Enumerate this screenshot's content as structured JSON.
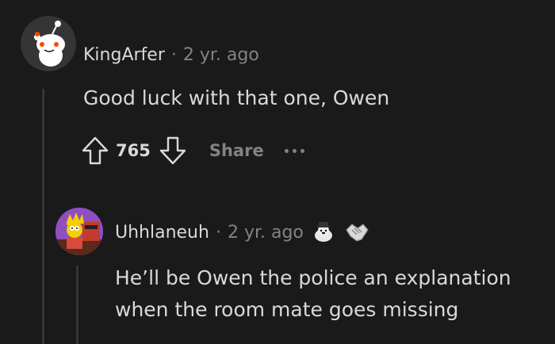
{
  "comments": [
    {
      "username": "KingArfer",
      "separator": "·",
      "time": "2 yr. ago",
      "body": "Good luck with that one, Owen",
      "score": "765",
      "share_label": "Share",
      "avatar_icon": "snoo-avatar-icon"
    },
    {
      "username": "Uhhlaneuh",
      "separator": "·",
      "time": "2 yr. ago",
      "body_lines": [
        "He’ll be Owen the police an explanation",
        "when the room mate goes missing"
      ],
      "avatar_icon": "lisa-simpson-avatar-icon",
      "awards": [
        "wholesome-seal-award-icon",
        "handshake-award-icon"
      ]
    }
  ],
  "colors": {
    "background": "#1a1a1b",
    "text": "#d7dadc",
    "muted": "#818384",
    "thread_line": "#343536"
  }
}
